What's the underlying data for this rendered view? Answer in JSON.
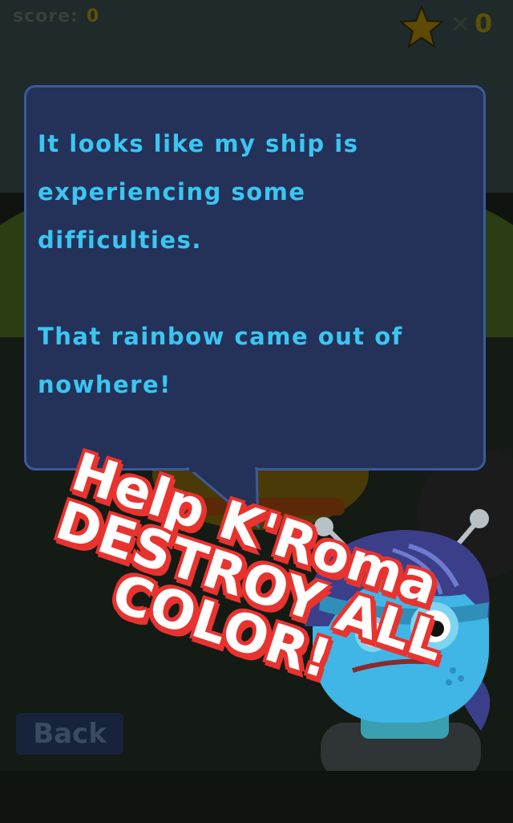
{
  "hud": {
    "score_label": "score:",
    "score_value": "0",
    "star_multiplier": "×",
    "star_count": "0"
  },
  "dialog": {
    "text": "It looks like my ship is\nexperiencing some\ndifficulties.\n\nThat rainbow came out of\nnowhere!"
  },
  "banner": {
    "line1": "Help K'Roma",
    "line2": "DESTROY ALL",
    "line3": "COLOR!"
  },
  "back_button": {
    "label": "Back"
  },
  "icons": {
    "star": "star-icon",
    "character": "alien-character"
  },
  "colors": {
    "bubble_bg": "#24325a",
    "bubble_border": "#3b5a9a",
    "dialog_text": "#3bc6f2",
    "banner_outline": "#e8332f",
    "banner_fill": "#ffffff",
    "alien_skin": "#3fb6e6",
    "alien_hair": "#3b3f8a"
  }
}
